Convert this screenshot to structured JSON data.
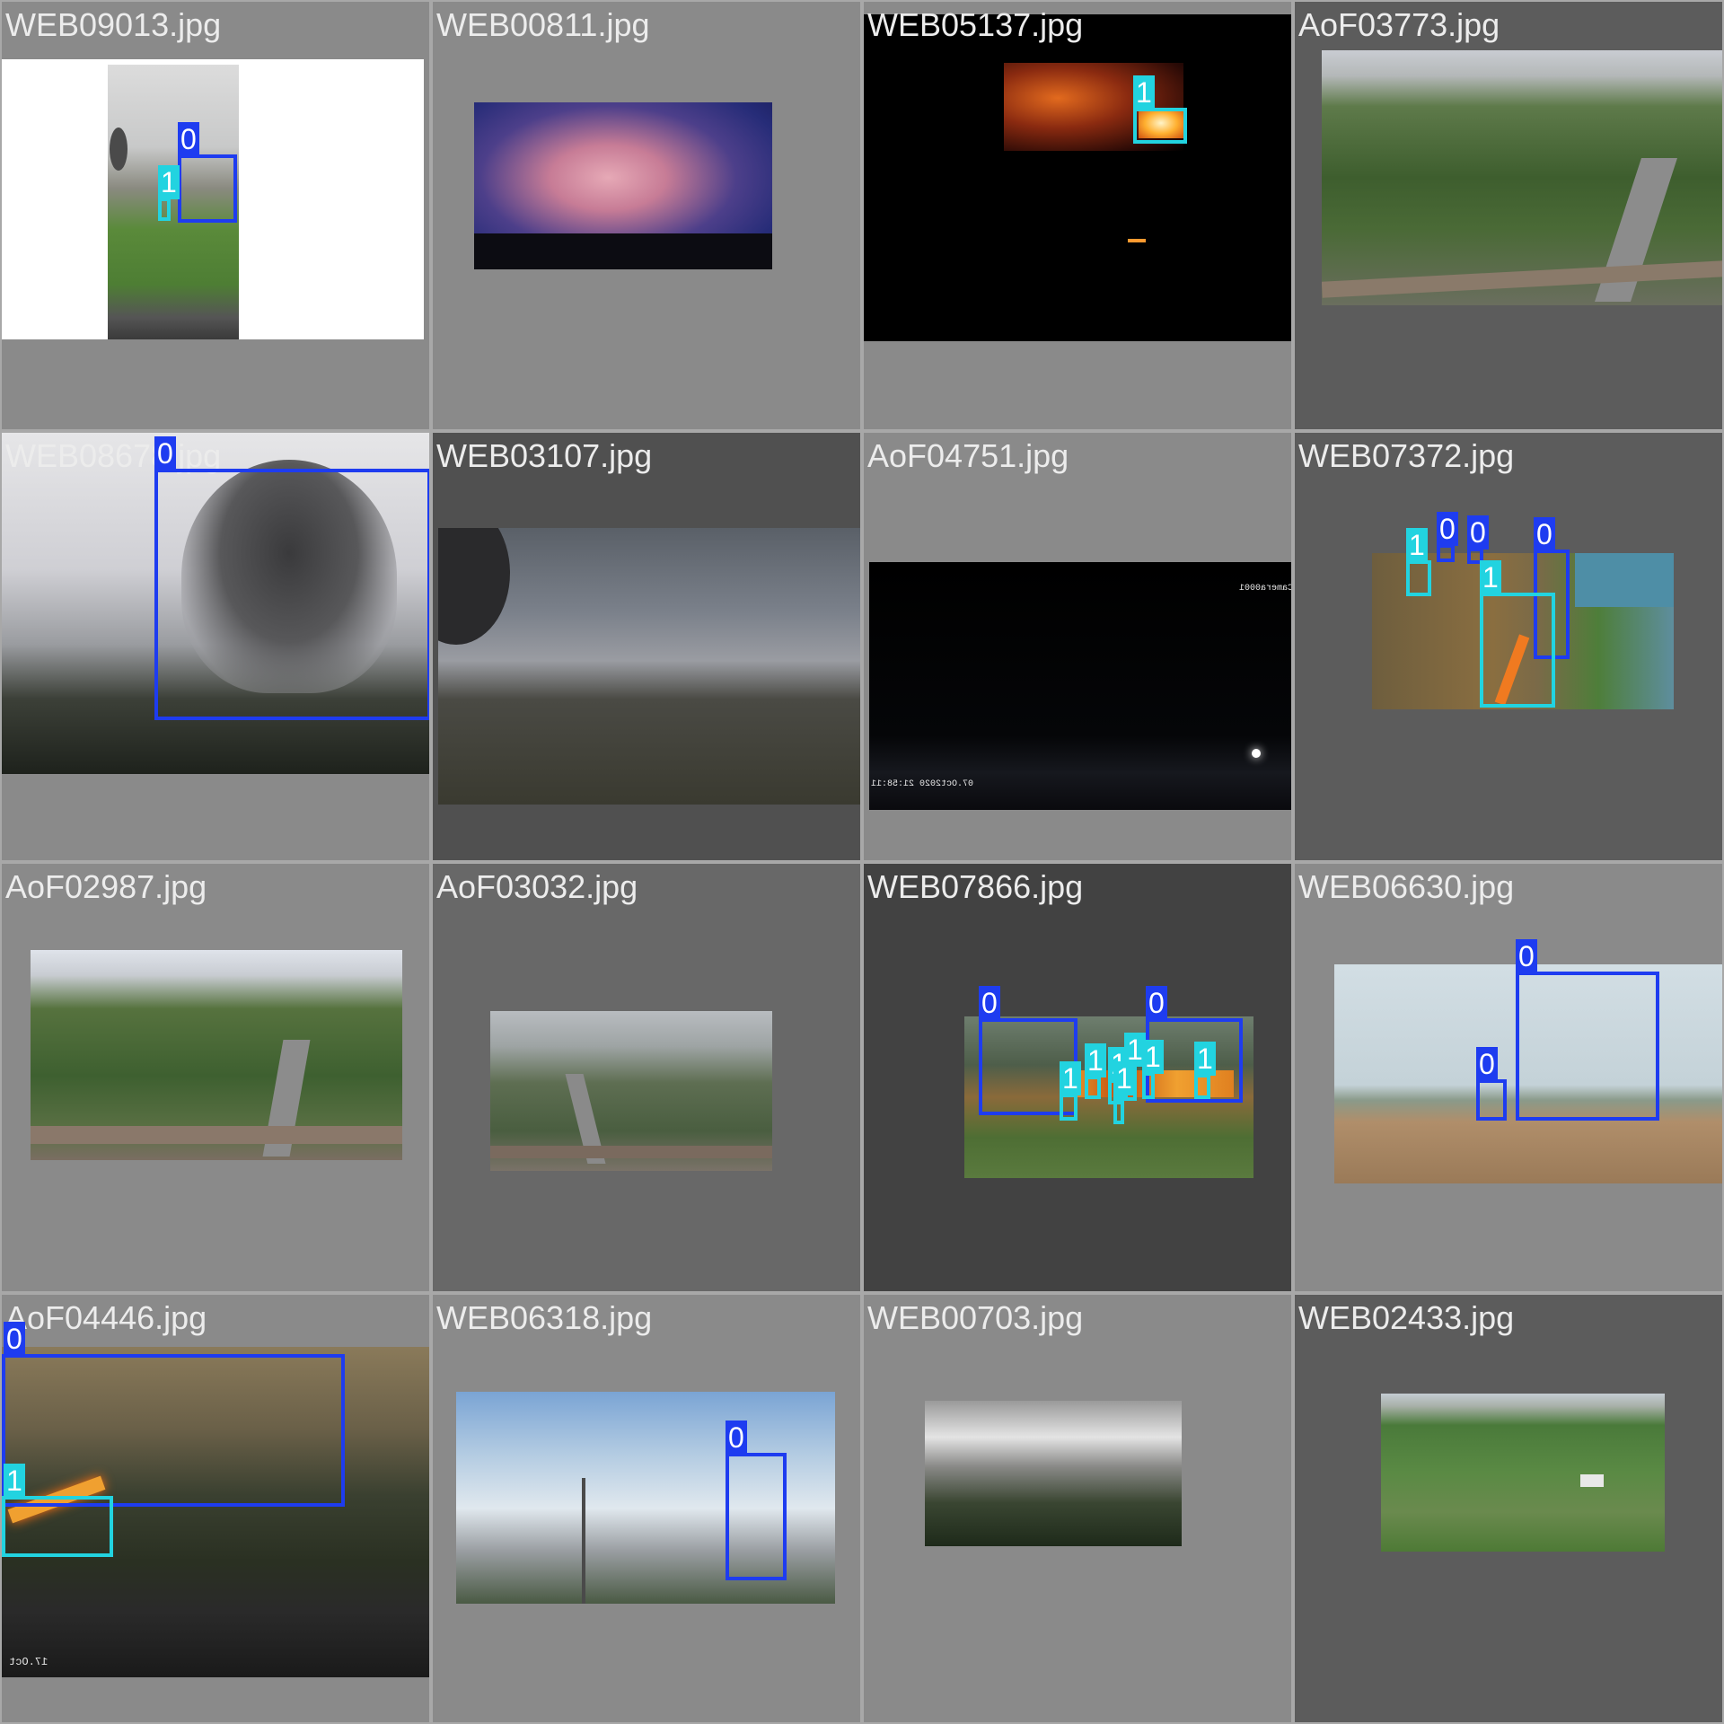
{
  "grid_title": "",
  "class_colors": {
    "0": "#1e3cf0",
    "1": "#22d3e0"
  },
  "tiles": [
    {
      "filename": "WEB09013.jpg",
      "labels": [
        "0",
        "1"
      ]
    },
    {
      "filename": "WEB00811.jpg",
      "labels": []
    },
    {
      "filename": "WEB05137.jpg",
      "labels": [
        "1"
      ]
    },
    {
      "filename": "AoF03773.jpg",
      "labels": []
    },
    {
      "filename": "WEB08678.jpg",
      "labels": [
        "0"
      ]
    },
    {
      "filename": "WEB03107.jpg",
      "labels": []
    },
    {
      "filename": "AoF04751.jpg",
      "labels": [],
      "overlay_text": [
        "07.Oct2020 21:58:11",
        "Camera0001"
      ]
    },
    {
      "filename": "WEB07372.jpg",
      "labels": [
        "1",
        "0",
        "0",
        "0",
        "1"
      ]
    },
    {
      "filename": "AoF02987.jpg",
      "labels": []
    },
    {
      "filename": "AoF03032.jpg",
      "labels": []
    },
    {
      "filename": "WEB07866.jpg",
      "labels": [
        "0",
        "0",
        "1",
        "1",
        "1",
        "1",
        "1",
        "1",
        "1"
      ]
    },
    {
      "filename": "WEB06630.jpg",
      "labels": [
        "0",
        "0"
      ]
    },
    {
      "filename": "AoF04446.jpg",
      "labels": [
        "0",
        "1"
      ],
      "overlay_text": [
        "17.Oct"
      ]
    },
    {
      "filename": "WEB06318.jpg",
      "labels": [
        "0"
      ]
    },
    {
      "filename": "WEB00703.jpg",
      "labels": []
    },
    {
      "filename": "WEB02433.jpg",
      "labels": []
    }
  ]
}
